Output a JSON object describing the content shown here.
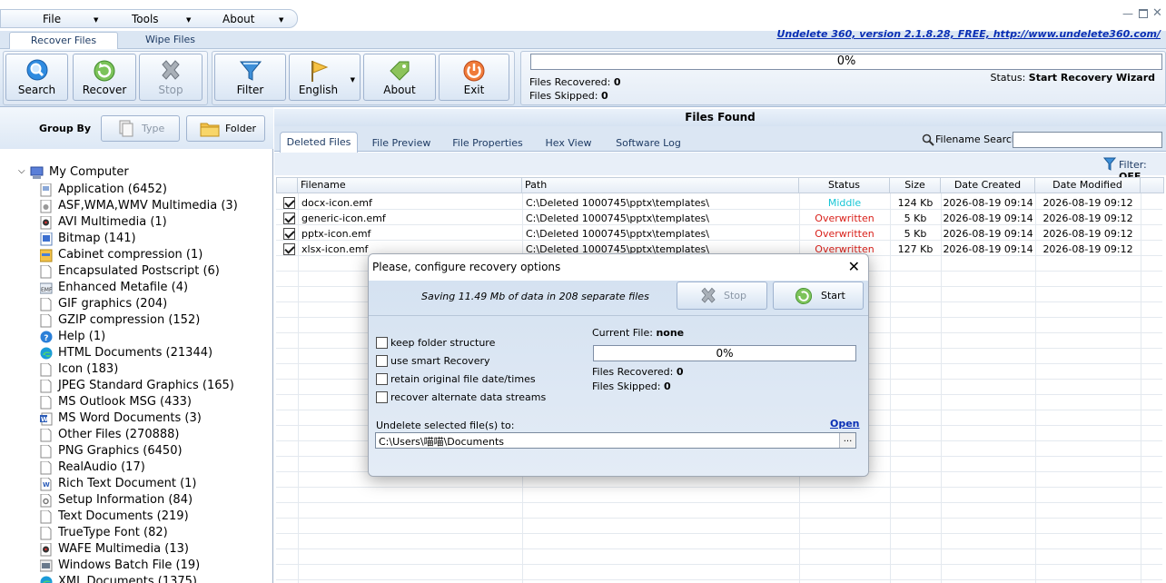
{
  "menu": {
    "file": "File",
    "tools": "Tools",
    "about": "About"
  },
  "main_tabs": {
    "recover": "Recover Files",
    "wipe": "Wipe Files"
  },
  "version_text": "Undelete 360, version 2.1.8.28, FREE, http://www.undelete360.com/",
  "toolbar": {
    "search": "Search",
    "recover": "Recover",
    "stop": "Stop",
    "filter": "Filter",
    "english": "English",
    "about": "About",
    "exit": "Exit"
  },
  "progress": {
    "percent": "0%",
    "files_recovered_label": "Files Recovered:",
    "files_recovered": "0",
    "files_skipped_label": "Files Skipped:",
    "files_skipped": "0",
    "status_label": "Status:",
    "status_value": "Start Recovery Wizard"
  },
  "group_by": {
    "label": "Group By",
    "type": "Type",
    "folder": "Folder"
  },
  "tree": {
    "root": "My Computer",
    "items": [
      {
        "label": "Application (6452)",
        "icon": "application-icon"
      },
      {
        "label": "ASF,WMA,WMV Multimedia (3)",
        "icon": "multimedia-icon"
      },
      {
        "label": "AVI Multimedia (1)",
        "icon": "video-icon"
      },
      {
        "label": "Bitmap (141)",
        "icon": "bitmap-icon"
      },
      {
        "label": "Cabinet compression (1)",
        "icon": "cabinet-icon"
      },
      {
        "label": "Encapsulated Postscript (6)",
        "icon": "document-icon"
      },
      {
        "label": "Enhanced Metafile (4)",
        "icon": "emf-icon"
      },
      {
        "label": "GIF graphics (204)",
        "icon": "document-icon"
      },
      {
        "label": "GZIP compression (152)",
        "icon": "document-icon"
      },
      {
        "label": "Help (1)",
        "icon": "help-icon"
      },
      {
        "label": "HTML Documents (21344)",
        "icon": "edge-icon"
      },
      {
        "label": "Icon (183)",
        "icon": "document-icon"
      },
      {
        "label": "JPEG Standard Graphics (165)",
        "icon": "document-icon"
      },
      {
        "label": "MS Outlook MSG (433)",
        "icon": "document-icon"
      },
      {
        "label": "MS Word Documents (3)",
        "icon": "word-icon"
      },
      {
        "label": "Other Files (270888)",
        "icon": "document-icon"
      },
      {
        "label": "PNG Graphics (6450)",
        "icon": "document-icon"
      },
      {
        "label": "RealAudio (17)",
        "icon": "document-icon"
      },
      {
        "label": "Rich Text Document (1)",
        "icon": "wordpad-icon"
      },
      {
        "label": "Setup Information (84)",
        "icon": "setup-icon"
      },
      {
        "label": "Text Documents (219)",
        "icon": "document-icon"
      },
      {
        "label": "TrueType Font (82)",
        "icon": "document-icon"
      },
      {
        "label": "WAFE Multimedia (13)",
        "icon": "video-icon"
      },
      {
        "label": "Windows Batch File (19)",
        "icon": "batch-icon"
      },
      {
        "label": "XML Documents (1375)",
        "icon": "edge-icon"
      }
    ]
  },
  "files_found": {
    "title": "Files Found",
    "tabs": [
      "Deleted Files",
      "File Preview",
      "File Properties",
      "Hex View",
      "Software Log"
    ],
    "filename_search_label": "Filename Search:",
    "filename_search_value": "",
    "filter_label": "Filter:",
    "filter_value": "OFF",
    "columns": [
      "Filename",
      "Path",
      "Status",
      "Size",
      "Date Created",
      "Date Modified"
    ],
    "rows": [
      {
        "filename": "docx-icon.emf",
        "path": "C:\\Deleted 1000745\\pptx\\templates\\",
        "status": "Middle",
        "status_color": "#19c6d6",
        "size": "124 Kb",
        "created": "2026-08-19 09:14",
        "modified": "2026-08-19 09:12"
      },
      {
        "filename": "generic-icon.emf",
        "path": "C:\\Deleted 1000745\\pptx\\templates\\",
        "status": "Overwritten",
        "status_color": "#d9201a",
        "size": "5 Kb",
        "created": "2026-08-19 09:14",
        "modified": "2026-08-19 09:12"
      },
      {
        "filename": "pptx-icon.emf",
        "path": "C:\\Deleted 1000745\\pptx\\templates\\",
        "status": "Overwritten",
        "status_color": "#d9201a",
        "size": "5 Kb",
        "created": "2026-08-19 09:14",
        "modified": "2026-08-19 09:12"
      },
      {
        "filename": "xlsx-icon.emf",
        "path": "C:\\Deleted 1000745\\pptx\\templates\\",
        "status": "Overwritten",
        "status_color": "#d9201a",
        "size": "127 Kb",
        "created": "2026-08-19 09:14",
        "modified": "2026-08-19 09:12"
      }
    ]
  },
  "dialog": {
    "title": "Please, configure recovery options",
    "saving_text": "Saving 11.49 Mb of data in 208 separate files",
    "stop": "Stop",
    "start": "Start",
    "options": [
      "keep folder structure",
      "use smart Recovery",
      "retain original file date/times",
      "recover alternate data streams"
    ],
    "current_file_label": "Current File:",
    "current_file_value": "none",
    "percent": "0%",
    "files_recovered_label": "Files Recovered:",
    "files_recovered": "0",
    "files_skipped_label": "Files Skipped:",
    "files_skipped": "0",
    "destination_label": "Undelete selected file(s) to:",
    "open_link": "Open",
    "destination_value": "C:\\Users\\喵喵\\Documents",
    "browse": "..."
  }
}
